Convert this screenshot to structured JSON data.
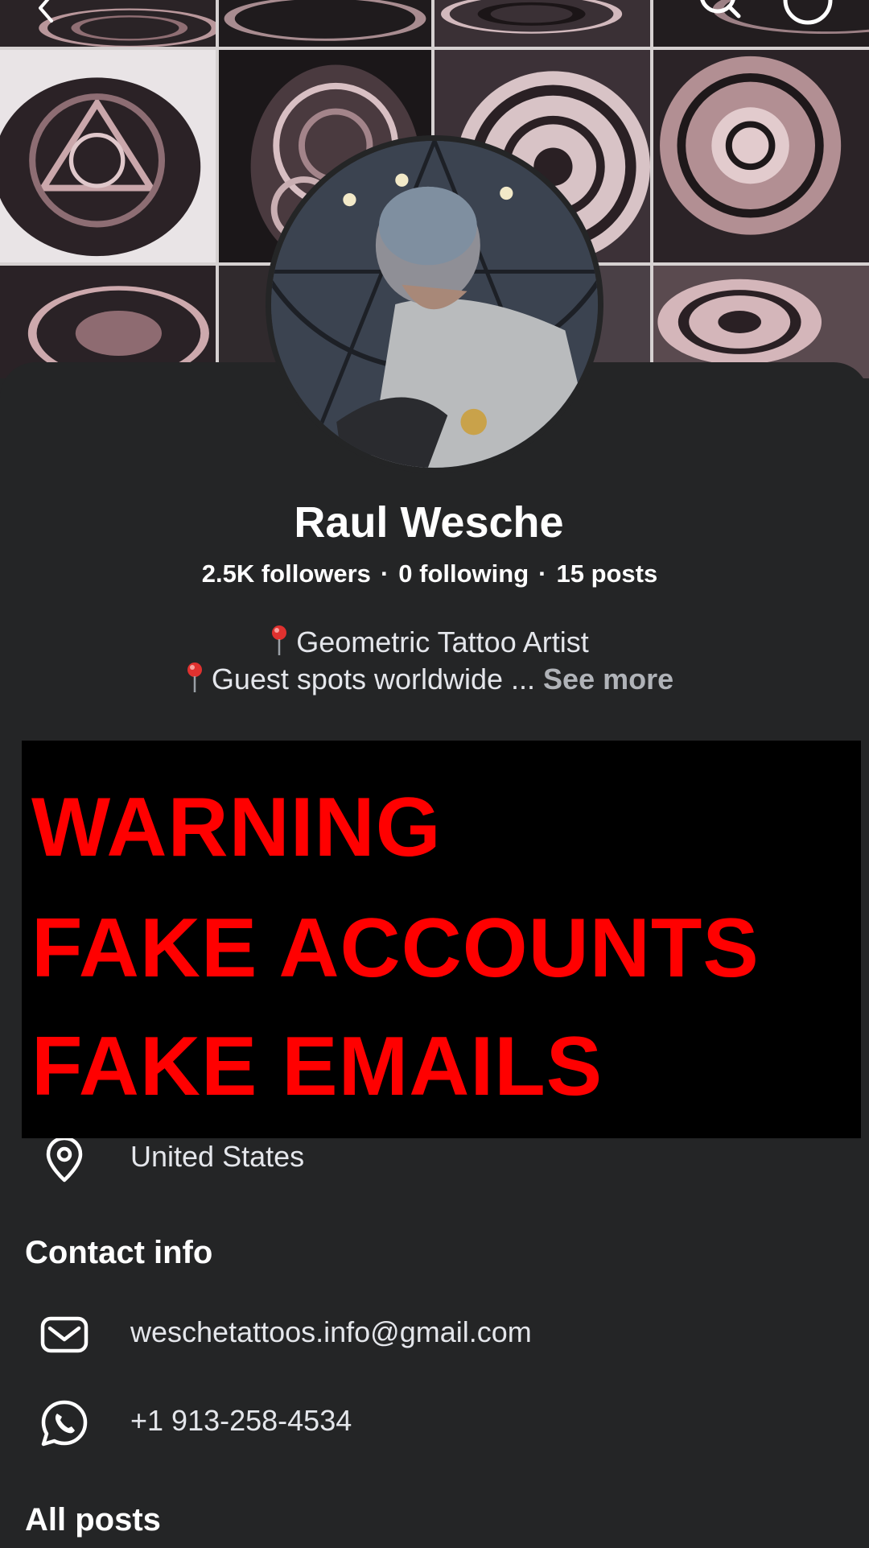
{
  "profile": {
    "name": "Raul Wesche",
    "followers": "2.5K followers",
    "following": "0 following",
    "posts": "15 posts",
    "separator": "·",
    "bio_line1": "Geometric Tattoo Artist",
    "bio_line2": "Guest spots worldwide ...",
    "see_more": "See more"
  },
  "warning": {
    "line1": "WARNING",
    "line2": "FAKE ACCOUNTS",
    "line3": "FAKE EMAILS",
    "color": "#ff0000"
  },
  "details": {
    "location": "United States"
  },
  "contact": {
    "title": "Contact info",
    "email": "weschetattoos.info@gmail.com",
    "phone": "+1 913-258-4534"
  },
  "posts_section": {
    "title": "All posts"
  },
  "icons": {
    "back": "chevron-left-icon",
    "search": "search-icon",
    "more": "more-options-icon",
    "location": "location-pin-icon",
    "email": "envelope-icon",
    "phone": "whatsapp-icon",
    "bio": "round-pushpin-emoji"
  },
  "colors": {
    "background": "#242526",
    "text": "#e4e6eb",
    "muted": "#b0b3b8",
    "warning_bg": "#000000",
    "warning_text": "#ff0000"
  }
}
